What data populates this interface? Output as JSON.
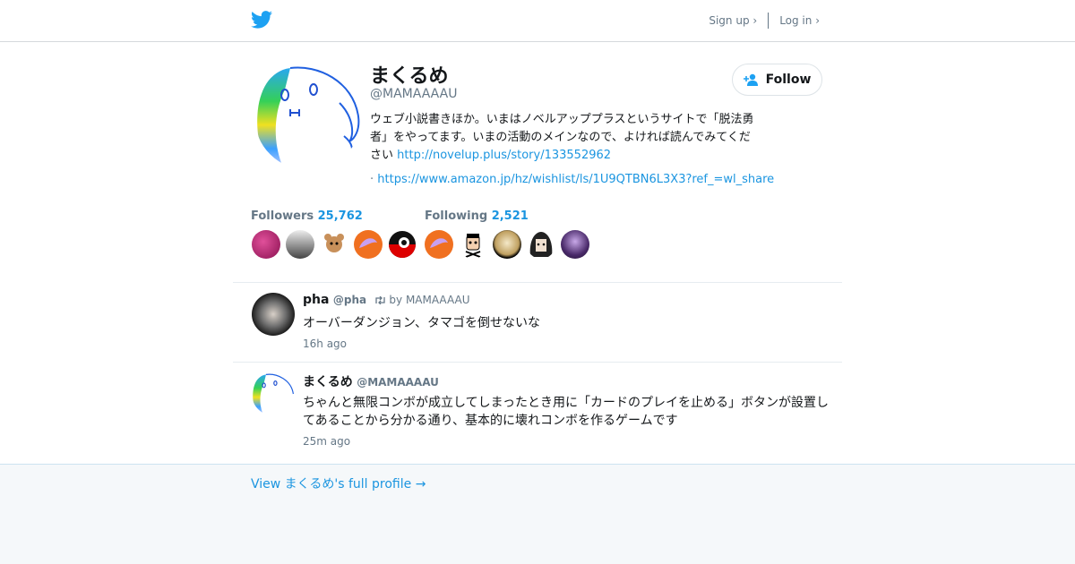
{
  "header": {
    "logo_icon": "twitter-bird-icon",
    "signup_label": "Sign up ›",
    "login_label": "Log in ›"
  },
  "profile": {
    "name": "まくるめ",
    "handle": "@MAMAAAAU",
    "bio_text": "ウェブ小説書きほか。いまはノベルアッププラスというサイトで「脱法勇者」をやってます。いまの活動のメインなので、よければ読んでみてください ",
    "bio_link": "http://novelup.plus/story/133552962",
    "second_prefix": "· ",
    "second_link": "https://www.amazon.jp/hz/wishlist/ls/1U9QTBN6L3X3?ref_=wl_share",
    "follow_label": "Follow"
  },
  "stats": {
    "followers_label": "Followers",
    "followers_count": "25,762",
    "following_label": "Following",
    "following_count": "2,521"
  },
  "tweets": [
    {
      "name": "pha",
      "handle": "@pha",
      "retweet_by": "by MAMAAAAU",
      "text": "オーバーダンジョン、タマゴを倒せないな",
      "time": "16h ago"
    },
    {
      "name": "まくるめ",
      "handle": "@MAMAAAAU",
      "text": "ちゃんと無限コンボが成立してしまったとき用に「カードのプレイを止める」ボタンが設置してあることから分かる通り、基本的に壊れコンボを作るゲームです",
      "time": "25m ago"
    }
  ],
  "footer": {
    "full_profile_label": "View まくるめ's full profile →"
  },
  "colors": {
    "link": "#1b95e0",
    "muted": "#657786",
    "background": "#f5f8fa"
  }
}
